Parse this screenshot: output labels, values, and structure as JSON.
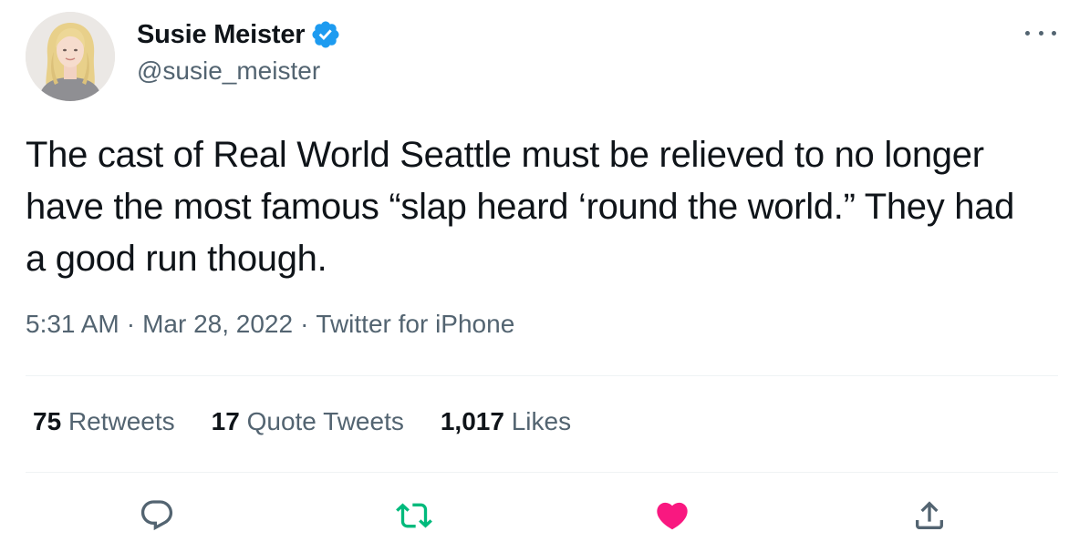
{
  "author": {
    "display_name": "Susie Meister",
    "handle": "@susie_meister",
    "verified_icon": "verified-badge-icon",
    "avatar": "avatar"
  },
  "tweet": {
    "text": "The cast of Real World Seattle must be relieved to no longer have the most famous “slap heard ‘round the world.” They had a good run though.",
    "time": "5:31 AM",
    "date": "Mar 28, 2022",
    "separator": "·",
    "source": "Twitter for iPhone"
  },
  "stats": {
    "retweets_count": "75",
    "retweets_label": "Retweets",
    "quotes_count": "17",
    "quotes_label": "Quote Tweets",
    "likes_count": "1,017",
    "likes_label": "Likes"
  },
  "actions": {
    "reply_icon": "reply-icon",
    "retweet_icon": "retweet-icon",
    "like_icon": "heart-icon",
    "share_icon": "share-icon"
  },
  "colors": {
    "verified": "#1d9bf0",
    "retweet": "#00ba7c",
    "like": "#f91880",
    "secondary_text": "#536471",
    "primary_text": "#0f1419"
  }
}
